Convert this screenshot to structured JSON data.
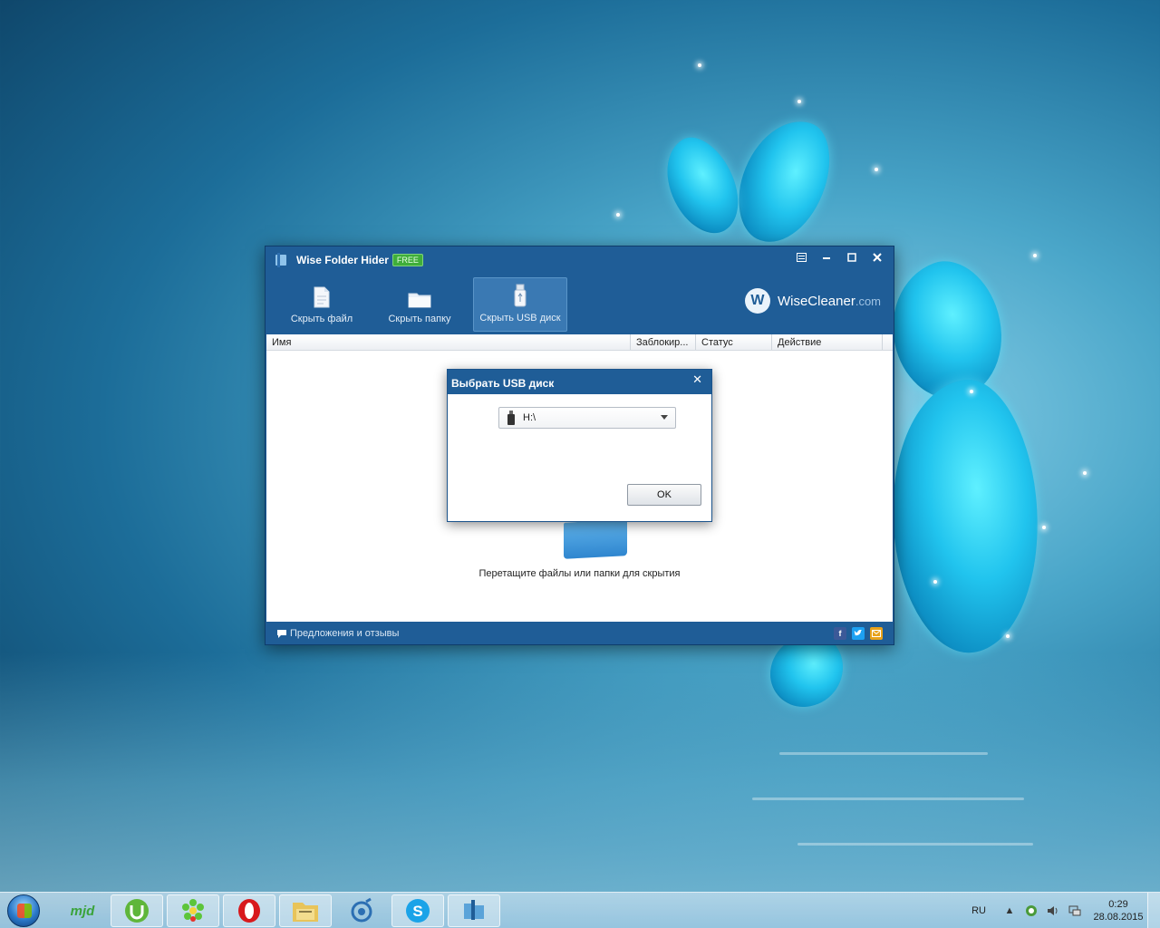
{
  "app": {
    "title": "Wise Folder Hider",
    "badge": "FREE",
    "brand_name": "WiseCleaner",
    "brand_domain": ".com",
    "brand_logo_letter": "W",
    "window_controls": [
      "menu-icon",
      "minimize-icon",
      "maximize-icon",
      "close-icon"
    ]
  },
  "toolbar": {
    "hide_file": "Скрыть файл",
    "hide_folder": "Скрыть папку",
    "hide_usb": "Скрыть USB диск"
  },
  "list": {
    "columns": [
      "Имя",
      "Заблокир...",
      "Статус",
      "Действие"
    ],
    "drop_hint": "Перетащите файлы или папки для скрытия"
  },
  "statusbar": {
    "feedback": "Предложения и отзывы",
    "social": [
      "facebook-icon",
      "twitter-icon",
      "email-icon"
    ]
  },
  "dialog": {
    "title": "Выбрать USB диск",
    "close": "✕",
    "selected_drive": "H:\\",
    "ok_label": "OK"
  },
  "taskbar": {
    "items": [
      "mydefrag-icon",
      "utorrent-icon",
      "icq-icon",
      "opera-icon",
      "file-explorer-icon",
      "qip-icon",
      "skype-icon",
      "wise-folder-hider-icon"
    ],
    "labels": {
      "mydefrag": "mjd"
    },
    "language": "RU",
    "time": "0:29",
    "date": "28.08.2015"
  },
  "colors": {
    "window_blue": "#1f5d97",
    "free_badge": "#3fae3a",
    "facebook": "#3b5998",
    "twitter": "#1da1f2",
    "email": "#e8a21a"
  }
}
